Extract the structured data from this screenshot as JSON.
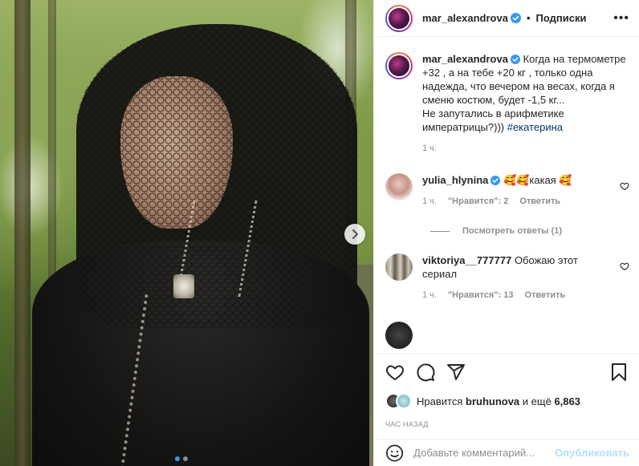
{
  "colors": {
    "accent": "#0095f6",
    "verified": "#3897f0",
    "hashtag": "#00376b",
    "muted": "#8e8e8e"
  },
  "post": {
    "image_alt_icon": "photo",
    "carousel": {
      "count": 2,
      "active": 1
    }
  },
  "header": {
    "username": "mar_alexandrova",
    "separator": "•",
    "follow_label": "Подписки",
    "more_label": "•••"
  },
  "caption": {
    "username": "mar_alexandrova",
    "text": "Когда на термометре +32 , а на тебе +20 кг , только одна надежда, что вечером на весах, когда я сменю костюм, будет -1,5 кг...\nНе запутались в арифметике императрицы?))) ",
    "hashtag": "#екатерина",
    "time": "1 ч."
  },
  "comments": [
    {
      "username": "yulia_hlynina",
      "verified": true,
      "text": "🥰🥰какая 🥰",
      "time": "1 ч.",
      "likes": "\"Нравится\": 2",
      "reply": "Ответить",
      "view_replies": "Посмотреть ответы (1)"
    },
    {
      "username": "viktoriya__777777",
      "verified": false,
      "text": "Обожаю этот сериал",
      "time": "1 ч.",
      "likes": "\"Нравится\": 13",
      "reply": "Ответить"
    }
  ],
  "likes_line": {
    "prefix": "Нравится",
    "user": "bruhunova",
    "joiner": "и ещё",
    "count": "6,863"
  },
  "timestamp": "ЧАС НАЗАД",
  "add_comment": {
    "placeholder": "Добавьте комментарий...",
    "publish_label": "Опубликовать"
  }
}
